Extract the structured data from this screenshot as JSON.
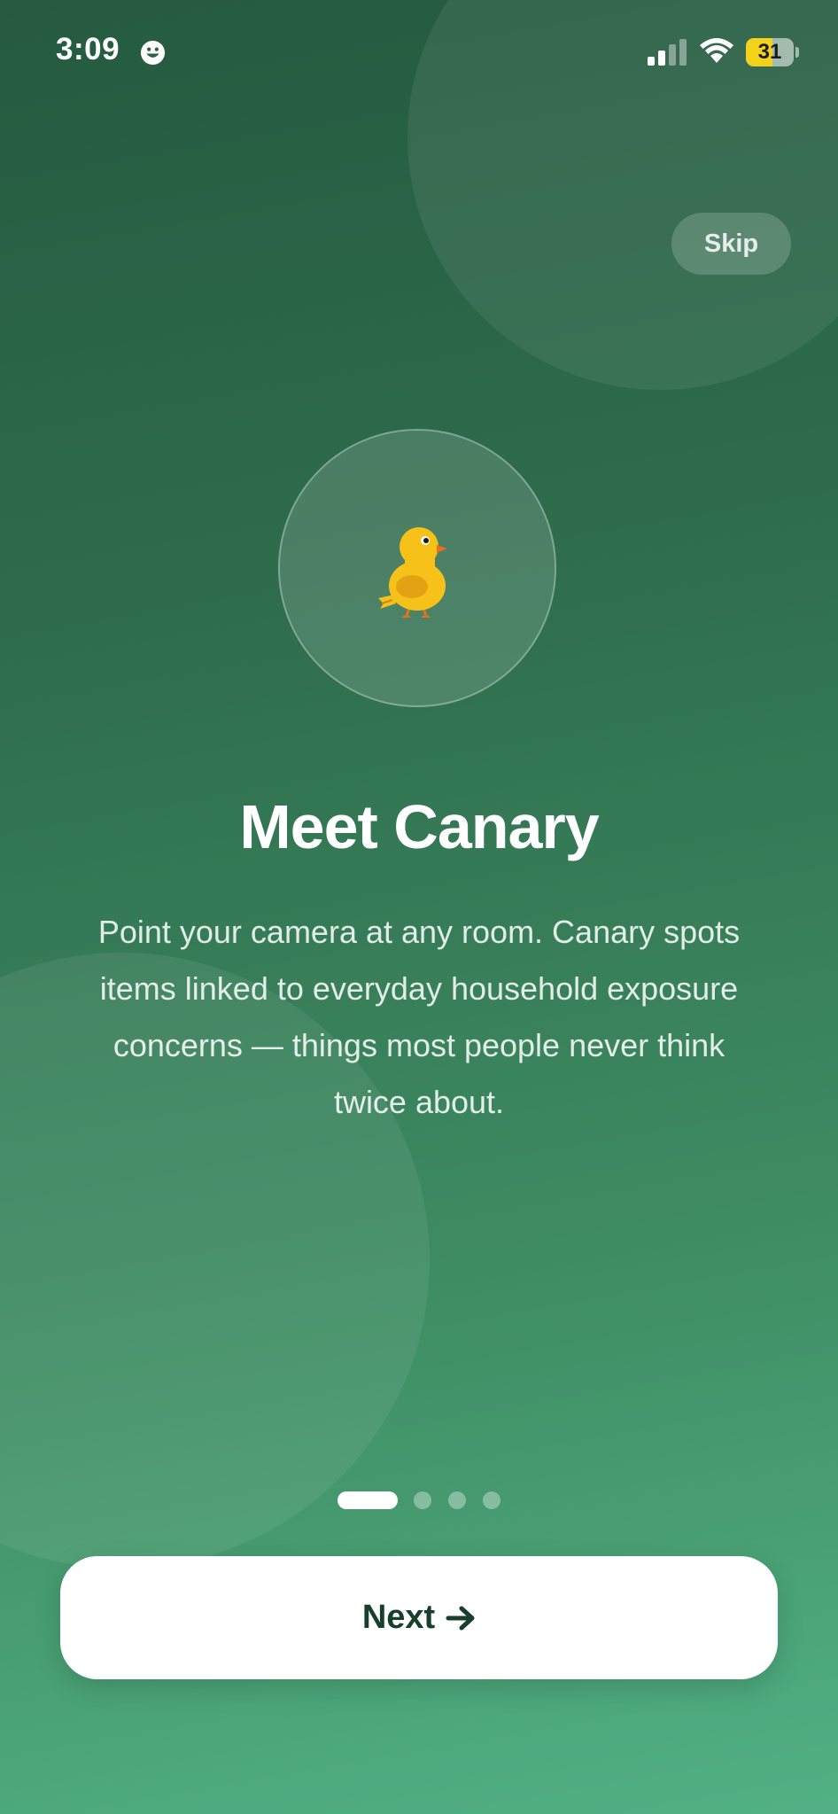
{
  "status_bar": {
    "time": "3:09",
    "battery_level": "31",
    "battery_percent": 31,
    "status_icon": "smiley-face-icon",
    "signal_icon": "cellular-signal-icon",
    "wifi_icon": "wifi-icon"
  },
  "onboarding": {
    "skip_label": "Skip",
    "hero_icon": "canary-bird-icon",
    "title": "Meet Canary",
    "description": "Point your camera at any room. Canary spots items linked to everyday household exposure concerns — things most people never think twice about.",
    "page_count": 4,
    "current_page": 1,
    "next_label": "Next",
    "next_icon": "arrow-right-icon"
  },
  "colors": {
    "background_top": "#255a40",
    "background_bottom": "#52b184",
    "button_text": "#173f2b",
    "bird_body": "#f6c21a",
    "battery_fill": "#f2d21b"
  }
}
